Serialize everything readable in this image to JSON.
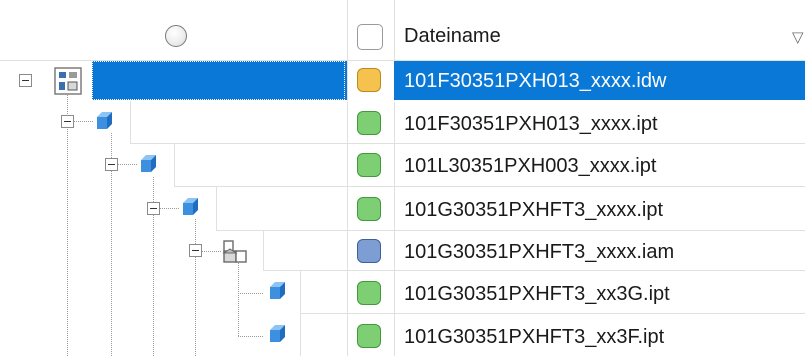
{
  "header": {
    "column_filename_label": "Dateiname",
    "status_column_icon": "circle-icon",
    "select_all_icon": "checkbox-icon",
    "filter_icon": "filter-icon"
  },
  "colors": {
    "selection": "#0a78d7",
    "status_idw": "#f5c24d",
    "status_ipt": "#7ecf73",
    "status_iam": "#7e9ed3"
  },
  "rows": [
    {
      "name": "101F30351PXH013_xxxx.idw",
      "status": "checked-out-yellow",
      "type_icon": "drawing-icon",
      "selected": true
    },
    {
      "name": "101F30351PXH013_xxxx.ipt",
      "status": "up-to-date-green",
      "type_icon": "part-icon",
      "selected": false
    },
    {
      "name": "101L30351PXH003_xxxx.ipt",
      "status": "up-to-date-green",
      "type_icon": "part-icon",
      "selected": false
    },
    {
      "name": "101G30351PXHFT3_xxxx.ipt",
      "status": "up-to-date-green",
      "type_icon": "part-icon",
      "selected": false
    },
    {
      "name": "101G30351PXHFT3_xxxx.iam",
      "status": "blue",
      "type_icon": "assembly-icon",
      "selected": false
    },
    {
      "name": "101G30351PXHFT3_xx3G.ipt",
      "status": "up-to-date-green",
      "type_icon": "part-icon",
      "selected": false
    },
    {
      "name": "101G30351PXHFT3_xx3F.ipt",
      "status": "up-to-date-green",
      "type_icon": "part-icon",
      "selected": false
    }
  ]
}
